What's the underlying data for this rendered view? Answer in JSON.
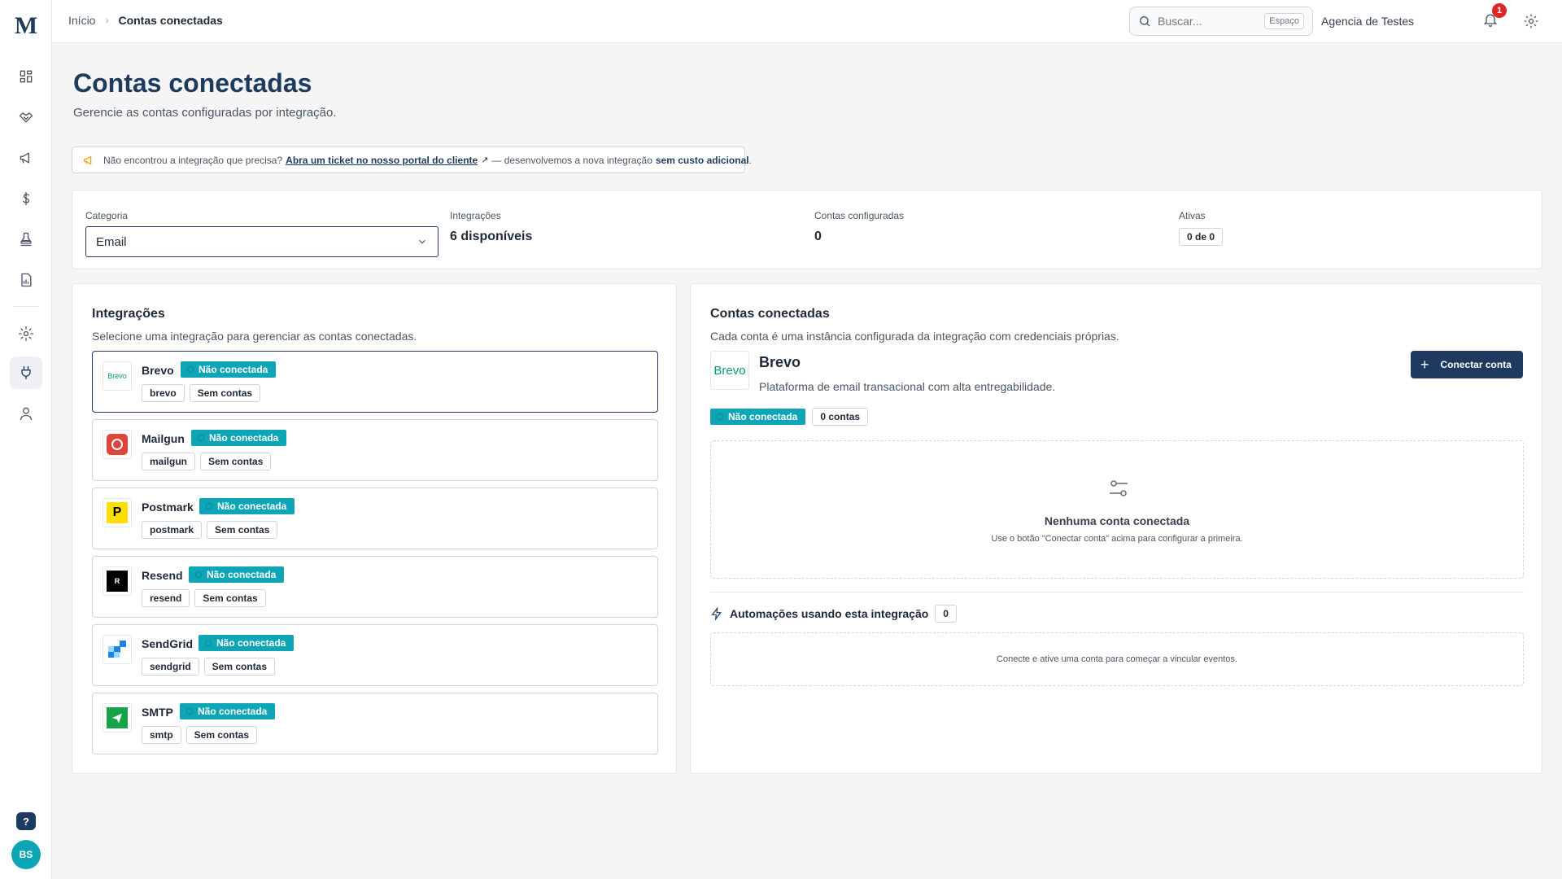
{
  "app": {
    "logo": "M"
  },
  "sidebar": {
    "items": [
      {
        "name": "dashboard",
        "icon": "grid-icon"
      },
      {
        "name": "deals",
        "icon": "handshake-icon"
      },
      {
        "name": "campaigns",
        "icon": "megaphone-icon"
      },
      {
        "name": "finance",
        "icon": "dollar-icon"
      },
      {
        "name": "approvals",
        "icon": "stamp-icon"
      },
      {
        "name": "reports",
        "icon": "report-icon"
      },
      {
        "name": "settings",
        "icon": "gear-icon"
      },
      {
        "name": "integrations",
        "icon": "plug-icon",
        "active": true
      },
      {
        "name": "users",
        "icon": "user-icon"
      }
    ],
    "help": "?",
    "avatar_initials": "BS"
  },
  "topbar": {
    "breadcrumb_home": "Início",
    "breadcrumb_current": "Contas conectadas",
    "search_placeholder": "Buscar...",
    "search_shortcut": "Espaço",
    "org_name": "Agencia de Testes",
    "notification_count": "1"
  },
  "page": {
    "title": "Contas conectadas",
    "subtitle": "Gerencie as contas configuradas por integração."
  },
  "notice": {
    "text_before": "Não encontrou a integração que precisa?",
    "link": "Abra um ticket no nosso portal do cliente",
    "text_after": "— desenvolvemos a nova integração",
    "bold": "sem custo adicional",
    "end": "."
  },
  "filters": {
    "category_label": "Categoria",
    "category_value": "Email",
    "integrations_label": "Integrações",
    "integrations_value": "6 disponíveis",
    "accounts_label": "Contas configuradas",
    "accounts_value": "0",
    "active_label": "Ativas",
    "active_value": "0 de 0"
  },
  "integrations_panel": {
    "title": "Integrações",
    "subtitle": "Selecione uma integração para gerenciar as contas conectadas.",
    "items": [
      {
        "name": "Brevo",
        "status": "Não conectada",
        "slug": "brevo",
        "accounts": "Sem contas",
        "logo_text": "Brevo",
        "selected": true
      },
      {
        "name": "Mailgun",
        "status": "Não conectada",
        "slug": "mailgun",
        "accounts": "Sem contas"
      },
      {
        "name": "Postmark",
        "status": "Não conectada",
        "slug": "postmark",
        "accounts": "Sem contas",
        "logo_text": "P"
      },
      {
        "name": "Resend",
        "status": "Não conectada",
        "slug": "resend",
        "accounts": "Sem contas",
        "logo_text": "R"
      },
      {
        "name": "SendGrid",
        "status": "Não conectada",
        "slug": "sendgrid",
        "accounts": "Sem contas"
      },
      {
        "name": "SMTP",
        "status": "Não conectada",
        "slug": "smtp",
        "accounts": "Sem contas"
      }
    ]
  },
  "accounts_panel": {
    "title": "Contas conectadas",
    "subtitle": "Cada conta é uma instância configurada da integração com credenciais próprias.",
    "integration_name": "Brevo",
    "integration_logo_text": "Brevo",
    "integration_desc": "Plataforma de email transacional com alta entregabilidade.",
    "connect_button": "Conectar conta",
    "status": "Não conectada",
    "accounts_count": "0 contas",
    "empty_title": "Nenhuma conta conectada",
    "empty_sub": "Use o botão \"Conectar conta\" acima para configurar a primeira.",
    "automations_title": "Automações usando esta integração",
    "automations_count": "0",
    "automations_empty": "Conecte e ative uma conta para começar a vincular eventos."
  },
  "colors": {
    "brand": "#1e3a5f",
    "status_teal": "#0ea5b7",
    "badge_red": "#dc2626"
  }
}
